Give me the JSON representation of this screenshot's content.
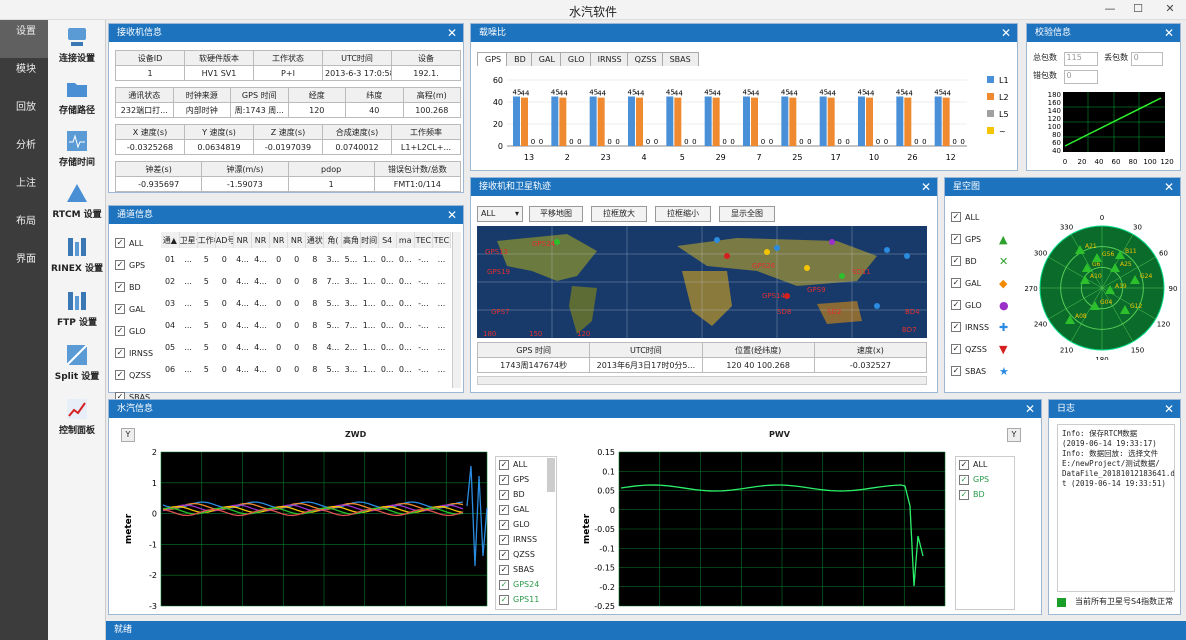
{
  "app": {
    "title": "水汽软件",
    "minimize": "—",
    "maximize": "☐",
    "close": "✕"
  },
  "nav": [
    "设置",
    "模块",
    "回放",
    "分析",
    "上注",
    "布局",
    "界面"
  ],
  "tools": [
    "连接设置",
    "存储路径",
    "存储时间",
    "RTCM 设置",
    "RINEX 设置",
    "FTP 设置",
    "Split 设置",
    "控制面板"
  ],
  "receiver": {
    "title": "接收机信息",
    "r1h": [
      "设备ID",
      "软硬件版本",
      "工作状态",
      "UTC时间",
      "设备"
    ],
    "r1v": [
      "1",
      "HV1 SV1",
      "P+I",
      "2013-6-3 17:0:58",
      "192.1."
    ],
    "r2h": [
      "通讯状态",
      "时钟来源",
      "GPS 时间",
      "经度",
      "纬度",
      "高程(m)"
    ],
    "r2v": [
      "232端口打...",
      "内部时钟",
      "周:1743 周...",
      "120",
      "40",
      "100.268"
    ],
    "r3h": [
      "X 速度(s)",
      "Y 速度(s)",
      "Z 速度(s)",
      "合成速度(s)",
      "工作频率"
    ],
    "r3v": [
      "-0.0325268",
      "0.0634819",
      "-0.0197039",
      "0.0740012",
      "L1+L2CL+..."
    ],
    "r4h": [
      "钟差(s)",
      "钟漂(m/s)",
      "pdop",
      "错误包计数/总数"
    ],
    "r4v": [
      "-0.935697",
      "-1.59073",
      "1",
      "FMT1:0/114"
    ]
  },
  "snr": {
    "title": "载噪比",
    "tabs": [
      "GPS",
      "BD",
      "GAL",
      "GLO",
      "IRNSS",
      "QZSS",
      "SBAS"
    ],
    "legend": [
      "L1",
      "L2",
      "L5",
      "~"
    ]
  },
  "chart_data": {
    "type": "bar",
    "categories": [
      "13",
      "2",
      "23",
      "4",
      "5",
      "29",
      "7",
      "25",
      "17",
      "10",
      "26",
      "12"
    ],
    "series": [
      {
        "name": "L1",
        "values": [
          45,
          45,
          45,
          45,
          45,
          45,
          45,
          45,
          45,
          45,
          45,
          45
        ]
      },
      {
        "name": "L2",
        "values": [
          44,
          44,
          44,
          44,
          44,
          44,
          44,
          44,
          44,
          44,
          44,
          44
        ]
      },
      {
        "name": "L5",
        "values": [
          0,
          0,
          0,
          0,
          0,
          0,
          0,
          0,
          0,
          0,
          0,
          0
        ]
      },
      {
        "name": "~",
        "values": [
          0,
          0,
          0,
          0,
          0,
          0,
          0,
          0,
          0,
          0,
          0,
          0
        ]
      }
    ],
    "ylim": [
      0,
      60
    ],
    "yticks": [
      "60",
      "40",
      "20",
      "0"
    ],
    "colors": [
      "#4a90d9",
      "#f08a30",
      "#a0a0a0",
      "#f5c400"
    ]
  },
  "check": {
    "title": "校验信息",
    "total": "总包数",
    "total_v": "115",
    "lost": "丢包数",
    "lost_v": "0",
    "err": "错包数",
    "err_v": "0",
    "yticks": [
      "180",
      "160",
      "140",
      "120",
      "100",
      "80",
      "60",
      "40"
    ],
    "xticks": [
      "0",
      "20",
      "40",
      "60",
      "80",
      "100",
      "120"
    ]
  },
  "channel": {
    "title": "通道信息",
    "checks": [
      "ALL",
      "GPS",
      "BD",
      "GAL",
      "GLO",
      "IRNSS",
      "QZSS",
      "SBAS"
    ],
    "cols": [
      "通▲",
      "卫星号",
      "工作模",
      "AD号",
      "NR",
      "NR",
      "NR",
      "NR",
      "通状",
      "角(",
      "高角",
      "时间",
      "S4",
      "ma",
      "TEC",
      "TEC"
    ],
    "rows": [
      [
        "01",
        "...",
        "5",
        "0",
        "4...",
        "4...",
        "0",
        "0",
        "8",
        "3...",
        "5...",
        "1...",
        "0...",
        "0...",
        "-...",
        "..."
      ],
      [
        "02",
        "...",
        "5",
        "0",
        "4...",
        "4...",
        "0",
        "0",
        "8",
        "7...",
        "3...",
        "1...",
        "0...",
        "0...",
        "-...",
        "..."
      ],
      [
        "03",
        "...",
        "5",
        "0",
        "4...",
        "4...",
        "0",
        "0",
        "8",
        "5...",
        "3...",
        "1...",
        "0...",
        "0...",
        "-...",
        "..."
      ],
      [
        "04",
        "...",
        "5",
        "0",
        "4...",
        "4...",
        "0",
        "0",
        "8",
        "5...",
        "7...",
        "1...",
        "0...",
        "0...",
        "-...",
        "..."
      ],
      [
        "05",
        "...",
        "5",
        "0",
        "4...",
        "4...",
        "0",
        "0",
        "8",
        "4...",
        "2...",
        "1...",
        "0...",
        "0...",
        "-...",
        "..."
      ],
      [
        "06",
        "...",
        "5",
        "0",
        "4...",
        "4...",
        "0",
        "0",
        "8",
        "5...",
        "3...",
        "1...",
        "0...",
        "0...",
        "-...",
        "..."
      ]
    ]
  },
  "track": {
    "title": "接收机和卫星轨迹",
    "select": "ALL",
    "buttons": [
      "平移地图",
      "拉框放大",
      "拉框缩小",
      "显示全图"
    ],
    "cols": [
      "GPS 时间",
      "UTC时间",
      "位置(经纬度)",
      "速度(x)"
    ],
    "row": [
      "1743周147674秒",
      "2013年6月3日17时0分5...",
      "120 40 100.268",
      "-0.032527"
    ],
    "labels": [
      "GPS13",
      "GPS19",
      "GPS7",
      "GPS14",
      "GPS9",
      "SD11",
      "BD4",
      "BD7",
      "SD2",
      "SD8",
      "GPS26",
      "GPS24"
    ],
    "degs": [
      "180",
      "150",
      "120"
    ]
  },
  "sky": {
    "title": "星空图",
    "checks": [
      "ALL",
      "GPS",
      "BD",
      "GAL",
      "GLO",
      "IRNSS",
      "QZSS",
      "SBAS"
    ],
    "marks": [
      "▲",
      "✕",
      "◆",
      "●",
      "✚",
      "▼",
      "★"
    ],
    "mcolors": [
      "#2ca02c",
      "#2ca02c",
      "#f08a00",
      "#9b30c9",
      "#2a8be0",
      "#d62020",
      "#2a8be0"
    ],
    "az": [
      "0",
      "30",
      "60",
      "90",
      "120",
      "150",
      "180",
      "210",
      "240",
      "270",
      "300",
      "330"
    ],
    "sats": [
      "A21",
      "A10",
      "A25",
      "B11",
      "G04",
      "G12",
      "A08",
      "G24",
      "A19",
      "G6",
      "G56"
    ]
  },
  "water": {
    "title": "水汽信息",
    "ybtn": "Y",
    "zwd": {
      "title": "ZWD",
      "ylabel": "meter",
      "yticks": [
        "2",
        "1",
        "0",
        "-1",
        "-2",
        "-3"
      ]
    },
    "pwv": {
      "title": "PWV",
      "ylabel": "meter",
      "yticks": [
        "0.15",
        "0.1",
        "0.05",
        "0",
        "-0.05",
        "-0.1",
        "-0.15",
        "-0.2",
        "-0.25"
      ]
    },
    "zchecks": [
      "ALL",
      "GPS",
      "BD",
      "GAL",
      "GLO",
      "IRNSS",
      "QZSS",
      "SBAS",
      "GPS24",
      "GPS11"
    ],
    "pchecks": [
      "ALL",
      "GPS",
      "BD"
    ]
  },
  "log": {
    "title": "日志",
    "lines": [
      "Info: 保存RTCM数据",
      "(2019-06-14 19:33:17)",
      "Info: 数据回放: 选择文件",
      "E:/newProject/测试数据/",
      "DataFile_20181012183641.da",
      "t (2019-06-14 19:33:51)"
    ],
    "status": "当前所有卫星号S4指数正常"
  },
  "statusbar": "就绪"
}
